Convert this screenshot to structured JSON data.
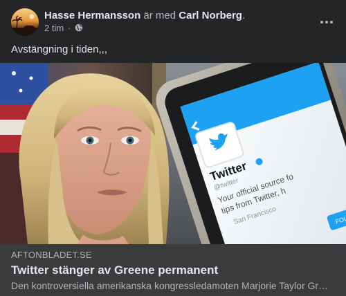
{
  "post": {
    "author": "Hasse Hermansson",
    "with_text": " är med ",
    "tagged": "Carl Norberg",
    "tagged_suffix": ".",
    "timestamp": "2 tim",
    "separator": "·",
    "audience_icon": "globe-icon",
    "more_icon": "more-options-icon",
    "text": "Avstängning i tiden,,,"
  },
  "link": {
    "domain": "AFTONBLADET.SE",
    "title": "Twitter stänger av Greene permanent",
    "description": "Den kontroversiella amerikanska kongressledamoten Marjorie Taylor Greene",
    "phone_screen": {
      "name": "Twitter",
      "handle": "@twitter",
      "bio_lines": [
        "Your official source fo",
        "tips from Twitter, h"
      ],
      "location": "San Francisco",
      "stats": "FOLLOW"
    }
  },
  "colors": {
    "background": "#242526",
    "preview_background": "#3a3b3c",
    "primary_text": "#e4e6eb",
    "secondary_text": "#b0b3b8",
    "twitter_blue": "#1da1f2"
  }
}
